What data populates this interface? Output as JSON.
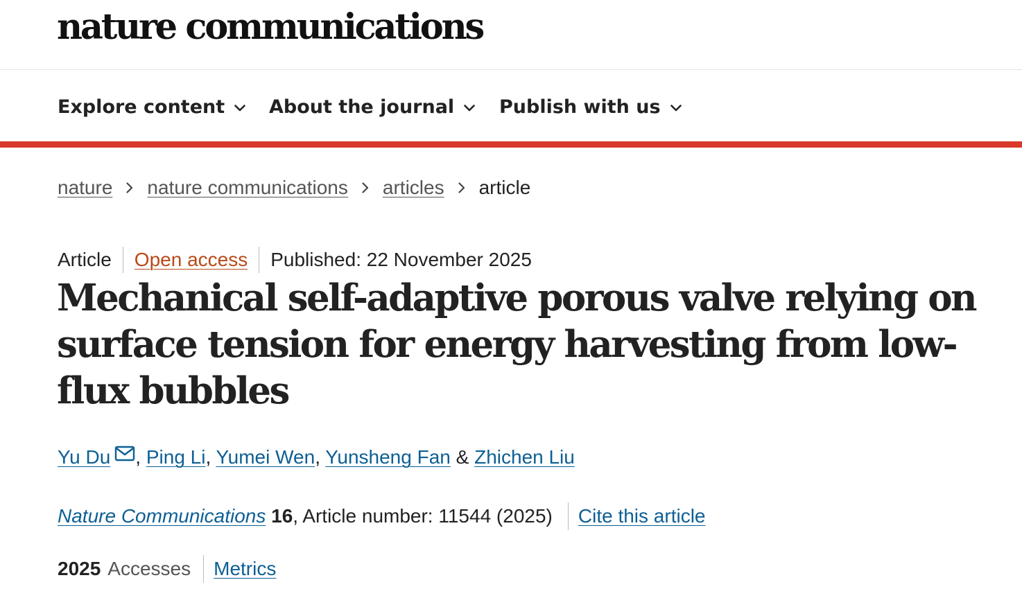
{
  "brand": {
    "logo_text": "nature communications"
  },
  "nav": {
    "items": [
      {
        "label": "Explore content",
        "icon": "chevron-down-icon"
      },
      {
        "label": "About the journal",
        "icon": "chevron-down-icon"
      },
      {
        "label": "Publish with us",
        "icon": "chevron-down-icon"
      }
    ],
    "accent_color": "#d8392a"
  },
  "breadcrumb": {
    "items": [
      "nature",
      "nature communications",
      "articles"
    ],
    "current": "article",
    "separator_icon": "chevron-right-icon"
  },
  "article": {
    "type": "Article",
    "access": "Open access",
    "published": "Published: 22 November 2025",
    "title": "Mechanical self-adaptive porous valve relying on surface tension for energy harvesting from low-flux bubbles",
    "authors": [
      {
        "name": "Yu Du",
        "corresponding": true
      },
      {
        "name": "Ping Li"
      },
      {
        "name": "Yumei Wen"
      },
      {
        "name": "Yunsheng Fan"
      },
      {
        "name": "Zhichen Liu"
      }
    ],
    "author_sep_comma": ", ",
    "author_sep_and": " & ",
    "mail_icon": "mail-icon"
  },
  "citation": {
    "journal": "Nature Communications",
    "volume": "16",
    "rest": ", Article number: 11544 (2025)",
    "cite_label": "Cite this article"
  },
  "metrics": {
    "accesses_count": "2025",
    "accesses_label": "Accesses",
    "metrics_link": "Metrics"
  },
  "colors": {
    "link": "#0d5f95",
    "open_access": "#b84a17",
    "text": "#222222"
  }
}
